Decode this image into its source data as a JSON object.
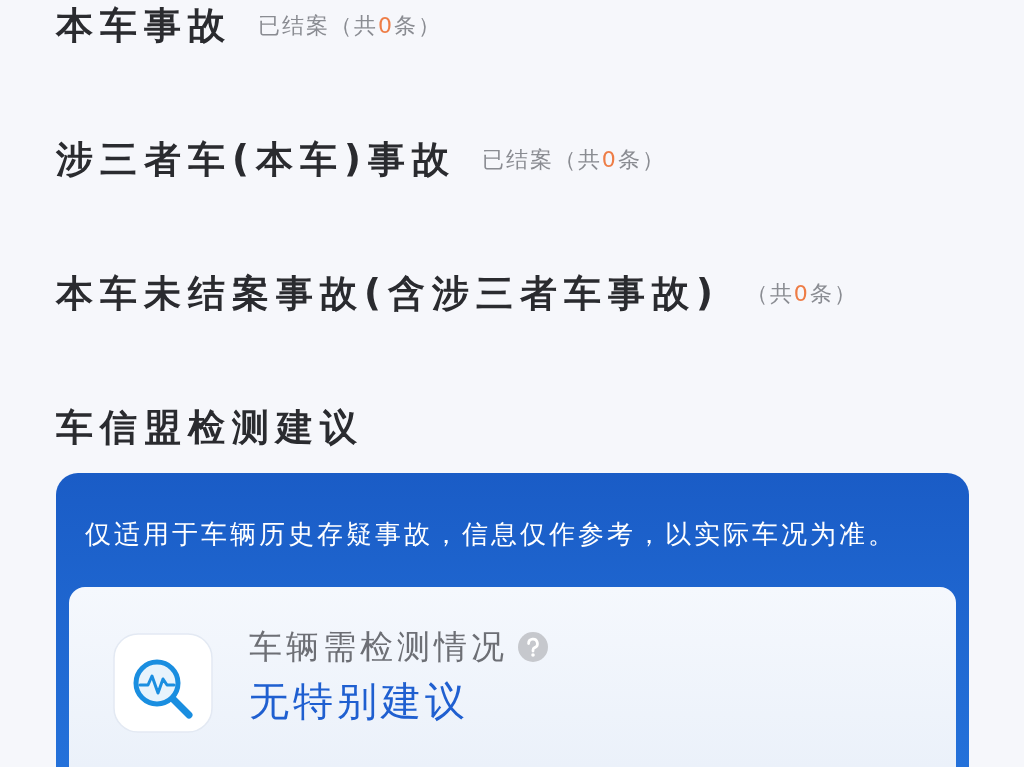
{
  "accident_sections": [
    {
      "title": "本车事故",
      "status": "已结案",
      "count_prefix": "（共",
      "count": "0",
      "count_suffix": "条）"
    },
    {
      "title": "涉三者车(本车)事故",
      "status": "已结案",
      "count_prefix": "（共",
      "count": "0",
      "count_suffix": "条）"
    },
    {
      "title": "本车未结案事故(含涉三者车事故)",
      "count_prefix": "（共",
      "count": "0",
      "count_suffix": "条）"
    }
  ],
  "advice": {
    "title": "车信盟检测建议",
    "notice": "仅适用于车辆历史存疑事故，信息仅作参考，以实际车况为准。",
    "result": {
      "label": "车辆需检测情况",
      "value": "无特别建议"
    }
  }
}
